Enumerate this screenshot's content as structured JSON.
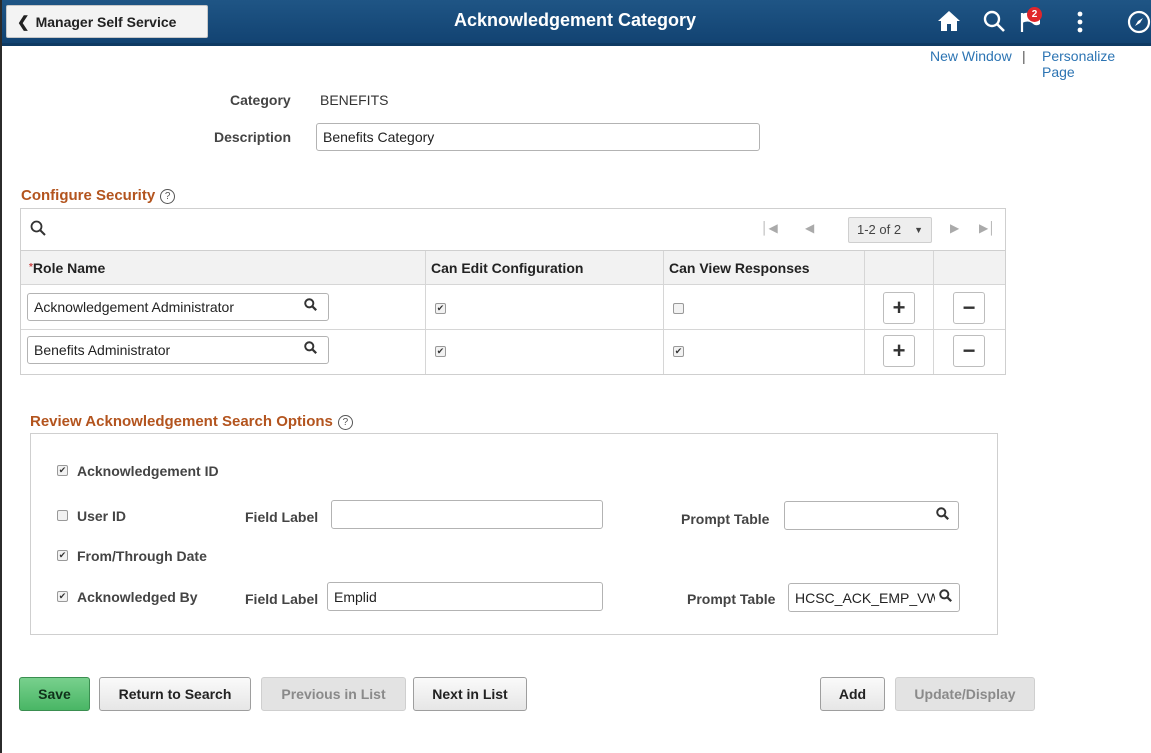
{
  "header": {
    "back_label": "Manager Self Service",
    "title": "Acknowledgement Category",
    "notification_count": "2",
    "icons": [
      "home-icon",
      "search-icon",
      "notification-flag-icon",
      "actions-menu-icon",
      "navbar-compass-icon"
    ]
  },
  "top_links": {
    "new_window": "New Window",
    "separator": "|",
    "personalize": "Personalize Page"
  },
  "category": {
    "category_label": "Category",
    "category_value": "BENEFITS",
    "description_label": "Description",
    "description_value": "Benefits Category"
  },
  "security": {
    "title": "Configure Security",
    "help": "?",
    "pager_text": "1-2 of 2",
    "columns": {
      "role_name": "Role Name",
      "can_edit": "Can Edit Configuration",
      "can_view": "Can View Responses"
    },
    "rows": [
      {
        "role": "Acknowledgement Administrator",
        "can_edit": true,
        "can_view": false
      },
      {
        "role": "Benefits Administrator",
        "can_edit": true,
        "can_view": true
      }
    ],
    "add_symbol": "+",
    "delete_symbol": "−"
  },
  "review": {
    "title": "Review Acknowledgement Search Options",
    "help": "?",
    "ack_id": {
      "label": "Acknowledgement ID",
      "checked": true
    },
    "user_id": {
      "label": "User ID",
      "checked": false,
      "field_label": "Field Label",
      "field_value": "",
      "prompt_label": "Prompt Table",
      "prompt_value": ""
    },
    "from_through": {
      "label": "From/Through Date",
      "checked": true
    },
    "ack_by": {
      "label": "Acknowledged By",
      "checked": true,
      "field_label": "Field Label",
      "field_value": "Emplid",
      "prompt_label": "Prompt Table",
      "prompt_value": "HCSC_ACK_EMP_VW"
    }
  },
  "buttons": {
    "save": "Save",
    "return_to_search": "Return to Search",
    "previous_in_list": "Previous in List",
    "next_in_list": "Next in List",
    "add": "Add",
    "update_display": "Update/Display"
  },
  "colors": {
    "banner": "#1a4d7c",
    "section_title": "#b3541e",
    "link": "#2c74b3",
    "save_button": "#5cbf76"
  }
}
